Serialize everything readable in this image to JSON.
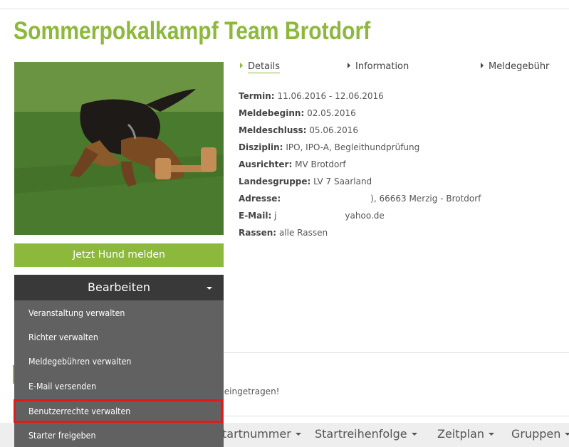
{
  "page": {
    "title": "Sommerpokalkampf Team Brotdorf"
  },
  "tabs": [
    {
      "label": "Details"
    },
    {
      "label": "Information"
    },
    {
      "label": "Meldegebühr"
    }
  ],
  "details": {
    "termin_label": "Termin:",
    "termin_value": "11.06.2016 - 12.06.2016",
    "meldebeginn_label": "Meldebeginn:",
    "meldebeginn_value": "02.05.2016",
    "meldeschluss_label": "Meldeschluss:",
    "meldeschluss_value": "05.06.2016",
    "disziplin_label": "Disziplin:",
    "disziplin_value": "IPO, IPO-A, Begleithundprüfung",
    "ausrichter_label": "Ausrichter:",
    "ausrichter_value": "MV Brotdorf",
    "landesgruppe_label": "Landesgruppe:",
    "landesgruppe_value": "LV 7 Saarland",
    "adresse_label": "Adresse:",
    "adresse_value": "), 66663 Merzig - Brotdorf",
    "email_label": "E-Mail:",
    "email_prefix": "j",
    "email_value": "yahoo.de",
    "rassen_label": "Rassen:",
    "rassen_value": "alle Rassen"
  },
  "buttons": {
    "melden": "Jetzt Hund melden",
    "bearbeiten": "Bearbeiten"
  },
  "dropdown": [
    {
      "label": "Veranstaltung verwalten"
    },
    {
      "label": "Richter verwalten"
    },
    {
      "label": "Meldegebühren verwalten"
    },
    {
      "label": "E-Mail versenden"
    },
    {
      "label": "Benutzerrechte verwalten"
    },
    {
      "label": "Starter freigeben"
    }
  ],
  "note": "r eingetragen!",
  "bottom_nav": [
    {
      "label": "tartnummer"
    },
    {
      "label": "Startreihenfolge"
    },
    {
      "label": "Zeitplan"
    },
    {
      "label": "Gruppen"
    }
  ],
  "colors": {
    "accent": "#8cb83c",
    "dark_button": "#393939",
    "dropdown_bg": "#616161",
    "highlight": "#e01b1b"
  }
}
